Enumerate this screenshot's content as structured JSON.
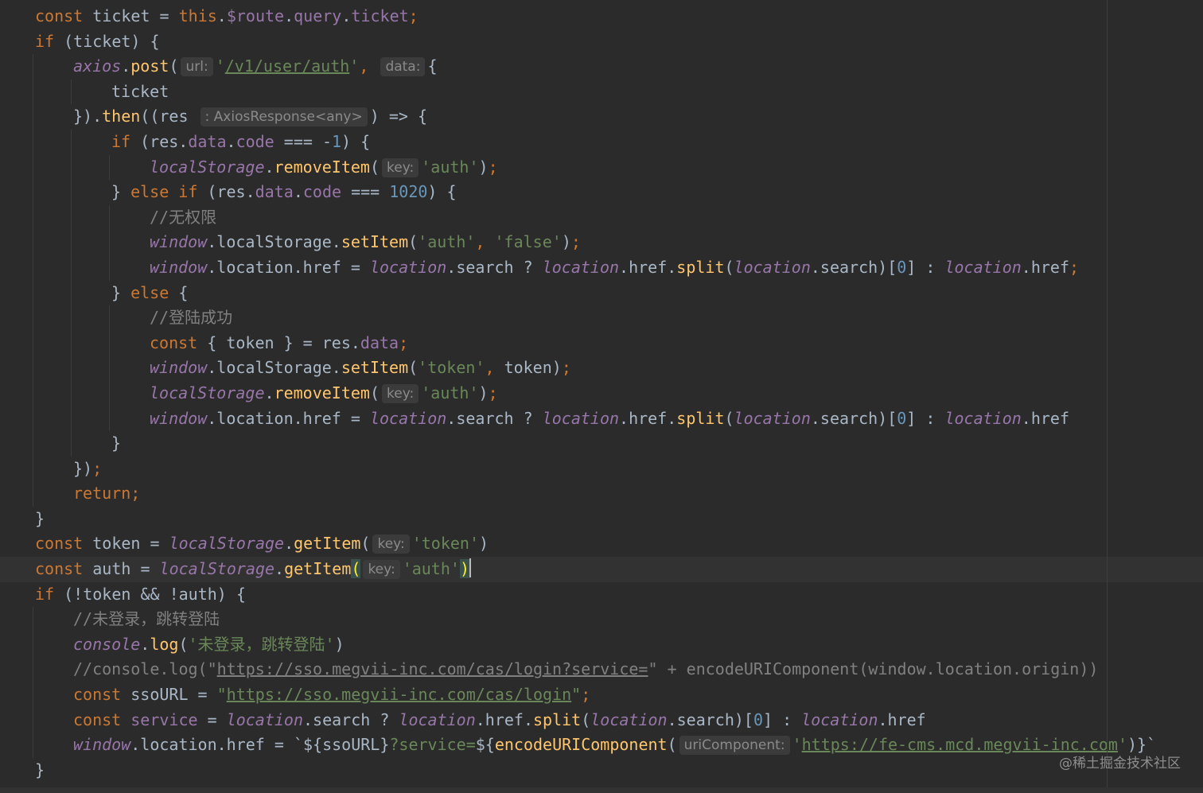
{
  "editor": {
    "watermark": "@稀土掘金技术社区",
    "lines": [
      {
        "indent": 0,
        "tokens": [
          {
            "t": "kw",
            "v": "const "
          },
          {
            "t": "plain",
            "v": "ticket = "
          },
          {
            "t": "kw",
            "v": "this"
          },
          {
            "t": "plain",
            "v": "."
          },
          {
            "t": "prop",
            "v": "$route"
          },
          {
            "t": "plain",
            "v": "."
          },
          {
            "t": "prop",
            "v": "query"
          },
          {
            "t": "plain",
            "v": "."
          },
          {
            "t": "prop",
            "v": "ticket"
          },
          {
            "t": "punc",
            "v": ";"
          }
        ]
      },
      {
        "indent": 0,
        "tokens": [
          {
            "t": "kw",
            "v": "if "
          },
          {
            "t": "plain",
            "v": "(ticket) {"
          }
        ]
      },
      {
        "indent": 1,
        "tokens": [
          {
            "t": "glob",
            "v": "axios"
          },
          {
            "t": "plain",
            "v": "."
          },
          {
            "t": "fn",
            "v": "post"
          },
          {
            "t": "plain",
            "v": "("
          },
          {
            "t": "hint",
            "v": "url:"
          },
          {
            "t": "str",
            "v": "'"
          },
          {
            "t": "strlink",
            "v": "/v1/user/auth"
          },
          {
            "t": "str",
            "v": "'"
          },
          {
            "t": "punc",
            "v": ", "
          },
          {
            "t": "hint",
            "v": "data:"
          },
          {
            "t": "plain",
            "v": "{"
          }
        ]
      },
      {
        "indent": 2,
        "tokens": [
          {
            "t": "plain",
            "v": "ticket"
          }
        ]
      },
      {
        "indent": 1,
        "tokens": [
          {
            "t": "plain",
            "v": "})."
          },
          {
            "t": "fn",
            "v": "then"
          },
          {
            "t": "plain",
            "v": "((res "
          },
          {
            "t": "hint",
            "v": ": AxiosResponse<any>"
          },
          {
            "t": "plain",
            "v": ") => {"
          }
        ]
      },
      {
        "indent": 2,
        "tokens": [
          {
            "t": "kw",
            "v": "if "
          },
          {
            "t": "plain",
            "v": "(res."
          },
          {
            "t": "prop",
            "v": "data"
          },
          {
            "t": "plain",
            "v": "."
          },
          {
            "t": "prop",
            "v": "code"
          },
          {
            "t": "plain",
            "v": " === -"
          },
          {
            "t": "num",
            "v": "1"
          },
          {
            "t": "plain",
            "v": ") {"
          }
        ]
      },
      {
        "indent": 3,
        "tokens": [
          {
            "t": "glob",
            "v": "localStorage"
          },
          {
            "t": "plain",
            "v": "."
          },
          {
            "t": "fn",
            "v": "removeItem"
          },
          {
            "t": "plain",
            "v": "("
          },
          {
            "t": "hint",
            "v": "key:"
          },
          {
            "t": "str",
            "v": "'auth'"
          },
          {
            "t": "plain",
            "v": ")"
          },
          {
            "t": "punc",
            "v": ";"
          }
        ]
      },
      {
        "indent": 2,
        "tokens": [
          {
            "t": "plain",
            "v": "} "
          },
          {
            "t": "kw",
            "v": "else if "
          },
          {
            "t": "plain",
            "v": "(res."
          },
          {
            "t": "prop",
            "v": "data"
          },
          {
            "t": "plain",
            "v": "."
          },
          {
            "t": "prop",
            "v": "code"
          },
          {
            "t": "plain",
            "v": " === "
          },
          {
            "t": "num",
            "v": "1020"
          },
          {
            "t": "plain",
            "v": ") {"
          }
        ]
      },
      {
        "indent": 3,
        "tokens": [
          {
            "t": "cmt",
            "v": "//无权限"
          }
        ]
      },
      {
        "indent": 3,
        "tokens": [
          {
            "t": "glob",
            "v": "window"
          },
          {
            "t": "plain",
            "v": ".localStorage."
          },
          {
            "t": "fn",
            "v": "setItem"
          },
          {
            "t": "plain",
            "v": "("
          },
          {
            "t": "str",
            "v": "'auth'"
          },
          {
            "t": "punc",
            "v": ", "
          },
          {
            "t": "str",
            "v": "'false'"
          },
          {
            "t": "plain",
            "v": ")"
          },
          {
            "t": "punc",
            "v": ";"
          }
        ]
      },
      {
        "indent": 3,
        "tokens": [
          {
            "t": "glob",
            "v": "window"
          },
          {
            "t": "plain",
            "v": ".location.href = "
          },
          {
            "t": "glob",
            "v": "location"
          },
          {
            "t": "plain",
            "v": ".search ? "
          },
          {
            "t": "glob",
            "v": "location"
          },
          {
            "t": "plain",
            "v": ".href."
          },
          {
            "t": "fn",
            "v": "split"
          },
          {
            "t": "plain",
            "v": "("
          },
          {
            "t": "glob",
            "v": "location"
          },
          {
            "t": "plain",
            "v": ".search)["
          },
          {
            "t": "num",
            "v": "0"
          },
          {
            "t": "plain",
            "v": "] : "
          },
          {
            "t": "glob",
            "v": "location"
          },
          {
            "t": "plain",
            "v": ".href"
          },
          {
            "t": "punc",
            "v": ";"
          }
        ]
      },
      {
        "indent": 2,
        "tokens": [
          {
            "t": "plain",
            "v": "} "
          },
          {
            "t": "kw",
            "v": "else "
          },
          {
            "t": "plain",
            "v": "{"
          }
        ]
      },
      {
        "indent": 3,
        "tokens": [
          {
            "t": "cmt",
            "v": "//登陆成功"
          }
        ]
      },
      {
        "indent": 3,
        "tokens": [
          {
            "t": "kw",
            "v": "const "
          },
          {
            "t": "plain",
            "v": "{ token } = res."
          },
          {
            "t": "prop",
            "v": "data"
          },
          {
            "t": "punc",
            "v": ";"
          }
        ]
      },
      {
        "indent": 3,
        "tokens": [
          {
            "t": "glob",
            "v": "window"
          },
          {
            "t": "plain",
            "v": ".localStorage."
          },
          {
            "t": "fn",
            "v": "setItem"
          },
          {
            "t": "plain",
            "v": "("
          },
          {
            "t": "str",
            "v": "'token'"
          },
          {
            "t": "punc",
            "v": ", "
          },
          {
            "t": "plain",
            "v": "token)"
          },
          {
            "t": "punc",
            "v": ";"
          }
        ]
      },
      {
        "indent": 3,
        "tokens": [
          {
            "t": "glob",
            "v": "localStorage"
          },
          {
            "t": "plain",
            "v": "."
          },
          {
            "t": "fn",
            "v": "removeItem"
          },
          {
            "t": "plain",
            "v": "("
          },
          {
            "t": "hint",
            "v": "key:"
          },
          {
            "t": "str",
            "v": "'auth'"
          },
          {
            "t": "plain",
            "v": ")"
          },
          {
            "t": "punc",
            "v": ";"
          }
        ]
      },
      {
        "indent": 3,
        "tokens": [
          {
            "t": "glob",
            "v": "window"
          },
          {
            "t": "plain",
            "v": ".location.href = "
          },
          {
            "t": "glob",
            "v": "location"
          },
          {
            "t": "plain",
            "v": ".search ? "
          },
          {
            "t": "glob",
            "v": "location"
          },
          {
            "t": "plain",
            "v": ".href."
          },
          {
            "t": "fn",
            "v": "split"
          },
          {
            "t": "plain",
            "v": "("
          },
          {
            "t": "glob",
            "v": "location"
          },
          {
            "t": "plain",
            "v": ".search)["
          },
          {
            "t": "num",
            "v": "0"
          },
          {
            "t": "plain",
            "v": "] : "
          },
          {
            "t": "glob",
            "v": "location"
          },
          {
            "t": "plain",
            "v": ".href"
          }
        ]
      },
      {
        "indent": 2,
        "tokens": [
          {
            "t": "plain",
            "v": "}"
          }
        ]
      },
      {
        "indent": 1,
        "tokens": [
          {
            "t": "plain",
            "v": "})"
          },
          {
            "t": "punc",
            "v": ";"
          }
        ]
      },
      {
        "indent": 1,
        "tokens": [
          {
            "t": "kw",
            "v": "return"
          },
          {
            "t": "punc",
            "v": ";"
          }
        ]
      },
      {
        "indent": 0,
        "tokens": [
          {
            "t": "plain",
            "v": "}"
          }
        ]
      },
      {
        "indent": 0,
        "tokens": [
          {
            "t": "kw",
            "v": "const "
          },
          {
            "t": "plain",
            "v": "token = "
          },
          {
            "t": "glob",
            "v": "localStorage"
          },
          {
            "t": "plain",
            "v": "."
          },
          {
            "t": "fn",
            "v": "getItem"
          },
          {
            "t": "plain",
            "v": "("
          },
          {
            "t": "hint",
            "v": "key:"
          },
          {
            "t": "str",
            "v": "'token'"
          },
          {
            "t": "plain",
            "v": ")"
          }
        ]
      },
      {
        "indent": 0,
        "current": true,
        "tokens": [
          {
            "t": "kw",
            "v": "const "
          },
          {
            "t": "plain",
            "v": "auth = "
          },
          {
            "t": "glob",
            "v": "localStorage"
          },
          {
            "t": "plain",
            "v": "."
          },
          {
            "t": "fn",
            "v": "getItem"
          },
          {
            "t": "curparen",
            "v": "("
          },
          {
            "t": "hint",
            "v": "key:"
          },
          {
            "t": "str",
            "v": "'auth'"
          },
          {
            "t": "curparen",
            "v": ")"
          },
          {
            "t": "caret",
            "v": ""
          }
        ]
      },
      {
        "indent": 0,
        "tokens": [
          {
            "t": "kw",
            "v": "if "
          },
          {
            "t": "plain",
            "v": "(!token && !auth) {"
          }
        ]
      },
      {
        "indent": 1,
        "tokens": [
          {
            "t": "cmt",
            "v": "//未登录，跳转登陆"
          }
        ]
      },
      {
        "indent": 1,
        "tokens": [
          {
            "t": "glob",
            "v": "console"
          },
          {
            "t": "plain",
            "v": "."
          },
          {
            "t": "fn",
            "v": "log"
          },
          {
            "t": "plain",
            "v": "("
          },
          {
            "t": "str",
            "v": "'未登录，跳转登陆'"
          },
          {
            "t": "plain",
            "v": ")"
          }
        ]
      },
      {
        "indent": 1,
        "tokens": [
          {
            "t": "cmt",
            "v": "//console.log(\""
          },
          {
            "t": "cmtlink",
            "v": "https://sso.megvii-inc.com/cas/login?service="
          },
          {
            "t": "cmt",
            "v": "\" + encodeURIComponent(window.location.origin))"
          }
        ]
      },
      {
        "indent": 1,
        "tokens": [
          {
            "t": "kw",
            "v": "const "
          },
          {
            "t": "plain",
            "v": "ssoURL = "
          },
          {
            "t": "str",
            "v": "\""
          },
          {
            "t": "strlink",
            "v": "https://sso.megvii-inc.com/cas/login"
          },
          {
            "t": "str",
            "v": "\""
          },
          {
            "t": "punc",
            "v": ";"
          }
        ]
      },
      {
        "indent": 1,
        "tokens": [
          {
            "t": "kw",
            "v": "const "
          },
          {
            "t": "prop",
            "v": "service"
          },
          {
            "t": "plain",
            "v": " = "
          },
          {
            "t": "glob",
            "v": "location"
          },
          {
            "t": "plain",
            "v": ".search ? "
          },
          {
            "t": "glob",
            "v": "location"
          },
          {
            "t": "plain",
            "v": ".href."
          },
          {
            "t": "fn",
            "v": "split"
          },
          {
            "t": "plain",
            "v": "("
          },
          {
            "t": "glob",
            "v": "location"
          },
          {
            "t": "plain",
            "v": ".search)["
          },
          {
            "t": "num",
            "v": "0"
          },
          {
            "t": "plain",
            "v": "] : "
          },
          {
            "t": "glob",
            "v": "location"
          },
          {
            "t": "plain",
            "v": ".href"
          }
        ]
      },
      {
        "indent": 1,
        "tokens": [
          {
            "t": "glob",
            "v": "window"
          },
          {
            "t": "plain",
            "v": ".location.href = "
          },
          {
            "t": "plain",
            "v": "`${ssoURL}"
          },
          {
            "t": "str",
            "v": "?service="
          },
          {
            "t": "plain",
            "v": "${"
          },
          {
            "t": "fn",
            "v": "encodeURIComponent"
          },
          {
            "t": "plain",
            "v": "("
          },
          {
            "t": "hint",
            "v": "uriComponent:"
          },
          {
            "t": "str",
            "v": "'"
          },
          {
            "t": "strlink",
            "v": "https://fe-cms.mcd.megvii-inc.com"
          },
          {
            "t": "str",
            "v": "'"
          },
          {
            "t": "plain",
            "v": ")}`"
          }
        ]
      },
      {
        "indent": 0,
        "tokens": [
          {
            "t": "plain",
            "v": "}"
          }
        ]
      }
    ]
  }
}
